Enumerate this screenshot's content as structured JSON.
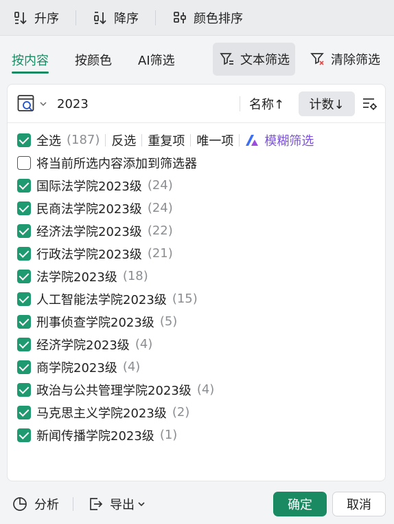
{
  "sortbar": {
    "asc_label": "升序",
    "desc_label": "降序",
    "color_label": "颜色排序"
  },
  "tabs": {
    "by_content": "按内容",
    "by_color": "按颜色",
    "ai_filter": "AI筛选",
    "text_filter": "文本筛选",
    "clear_filter": "清除筛选"
  },
  "search": {
    "value": "2023",
    "sort_name_label": "名称↑",
    "sort_count_label": "计数↓"
  },
  "list": {
    "select_all": {
      "label": "全选",
      "count": "(187)",
      "checked": true
    },
    "invert": "反选",
    "duplicates": "重复项",
    "unique": "唯一项",
    "fuzzy": "模糊筛选",
    "add_to_filter": {
      "label": "将当前所选内容添加到筛选器",
      "checked": false
    },
    "items": [
      {
        "label": "国际法学院2023级",
        "count": "(24)",
        "checked": true
      },
      {
        "label": "民商法学院2023级",
        "count": "(24)",
        "checked": true
      },
      {
        "label": "经济法学院2023级",
        "count": "(22)",
        "checked": true
      },
      {
        "label": "行政法学院2023级",
        "count": "(21)",
        "checked": true
      },
      {
        "label": "法学院2023级",
        "count": "(18)",
        "checked": true
      },
      {
        "label": "人工智能法学院2023级",
        "count": "(15)",
        "checked": true
      },
      {
        "label": "刑事侦查学院2023级",
        "count": "(5)",
        "checked": true
      },
      {
        "label": "经济学院2023级",
        "count": "(4)",
        "checked": true
      },
      {
        "label": "商学院2023级",
        "count": "(4)",
        "checked": true
      },
      {
        "label": "政治与公共管理学院2023级",
        "count": "(4)",
        "checked": true
      },
      {
        "label": "马克思主义学院2023级",
        "count": "(2)",
        "checked": true
      },
      {
        "label": "新闻传播学院2023级",
        "count": "(1)",
        "checked": true
      }
    ]
  },
  "footer": {
    "analyze": "分析",
    "export": "导出",
    "ok": "确定",
    "cancel": "取消"
  },
  "colors": {
    "accent": "#1a8a63",
    "checkbox": "#1f9a70",
    "fuzzy": "#7b53d6",
    "count_text": "#8a8d91"
  }
}
